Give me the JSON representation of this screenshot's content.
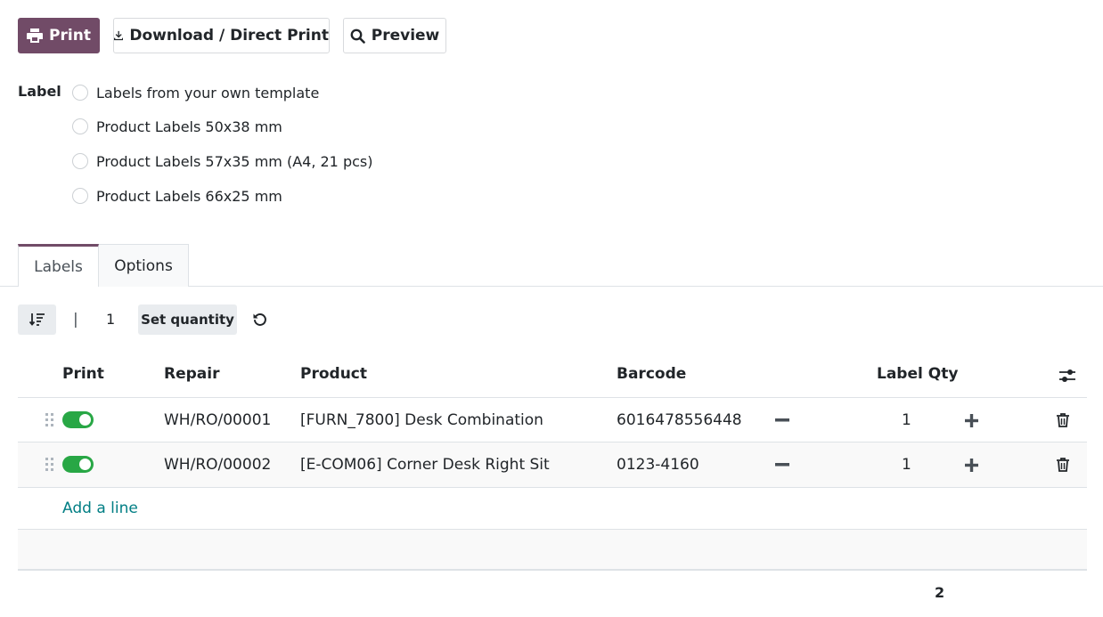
{
  "toolbar": {
    "print_label": "Print",
    "download_label": "Download / Direct Print",
    "preview_label": "Preview"
  },
  "label_section": {
    "title": "Label",
    "options": [
      "Labels from your own template",
      "Product Labels 50x38 mm",
      "Product Labels 57x35 mm (A4, 21 pcs)",
      "Product Labels 66x25 mm"
    ]
  },
  "tabs": [
    {
      "label": "Labels",
      "active": true
    },
    {
      "label": "Options",
      "active": false
    }
  ],
  "list_tools": {
    "separator": "|",
    "quantity": "1",
    "set_quantity_label": "Set quantity"
  },
  "table": {
    "columns": {
      "print": "Print",
      "repair": "Repair",
      "product": "Product",
      "barcode": "Barcode",
      "label_qty": "Label Qty"
    },
    "rows": [
      {
        "print": true,
        "repair": "WH/RO/00001",
        "product": "[FURN_7800] Desk Combination",
        "barcode": "6016478556448",
        "qty": "1"
      },
      {
        "print": true,
        "repair": "WH/RO/00002",
        "product": "[E-COM06] Corner Desk Right Sit",
        "barcode": "0123-4160",
        "qty": "1"
      }
    ],
    "add_line_label": "Add a line",
    "total_qty": "2"
  },
  "colors": {
    "brand": "#714B67",
    "toggle_on": "#28a745",
    "link": "#017e84"
  }
}
